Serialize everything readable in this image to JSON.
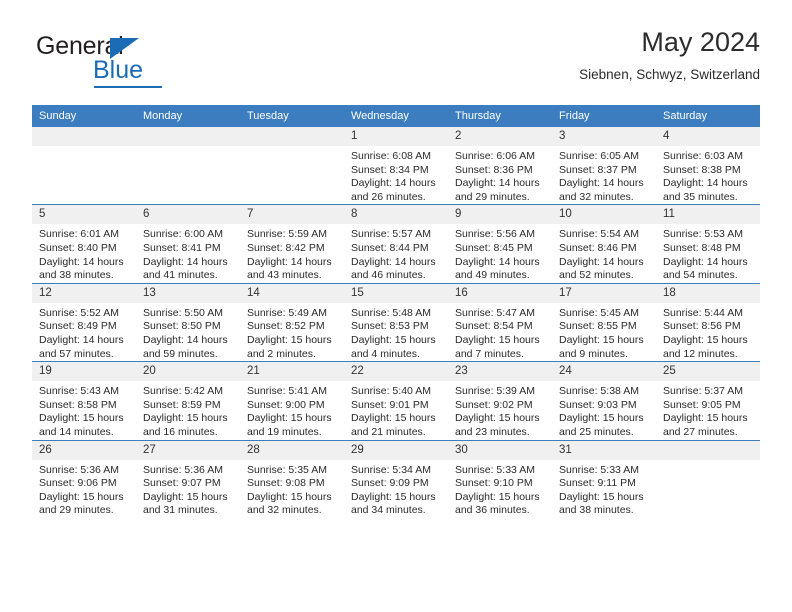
{
  "brand": {
    "name_part1": "General",
    "name_part2": "Blue",
    "accent_color": "#1b6cb5"
  },
  "header": {
    "title": "May 2024",
    "subtitle": "Siebnen, Schwyz, Switzerland"
  },
  "calendar": {
    "header_color": "#3b7dbf",
    "daynum_bg": "#f0f0f0",
    "weekday_headers": [
      "Sunday",
      "Monday",
      "Tuesday",
      "Wednesday",
      "Thursday",
      "Friday",
      "Saturday"
    ],
    "weeks": [
      [
        {
          "day": "",
          "blank": true,
          "sunrise": "",
          "sunset": "",
          "daylight": ""
        },
        {
          "day": "",
          "blank": true,
          "sunrise": "",
          "sunset": "",
          "daylight": ""
        },
        {
          "day": "",
          "blank": true,
          "sunrise": "",
          "sunset": "",
          "daylight": ""
        },
        {
          "day": "1",
          "sunrise": "Sunrise: 6:08 AM",
          "sunset": "Sunset: 8:34 PM",
          "daylight": "Daylight: 14 hours and 26 minutes."
        },
        {
          "day": "2",
          "sunrise": "Sunrise: 6:06 AM",
          "sunset": "Sunset: 8:36 PM",
          "daylight": "Daylight: 14 hours and 29 minutes."
        },
        {
          "day": "3",
          "sunrise": "Sunrise: 6:05 AM",
          "sunset": "Sunset: 8:37 PM",
          "daylight": "Daylight: 14 hours and 32 minutes."
        },
        {
          "day": "4",
          "sunrise": "Sunrise: 6:03 AM",
          "sunset": "Sunset: 8:38 PM",
          "daylight": "Daylight: 14 hours and 35 minutes."
        }
      ],
      [
        {
          "day": "5",
          "sunrise": "Sunrise: 6:01 AM",
          "sunset": "Sunset: 8:40 PM",
          "daylight": "Daylight: 14 hours and 38 minutes."
        },
        {
          "day": "6",
          "sunrise": "Sunrise: 6:00 AM",
          "sunset": "Sunset: 8:41 PM",
          "daylight": "Daylight: 14 hours and 41 minutes."
        },
        {
          "day": "7",
          "sunrise": "Sunrise: 5:59 AM",
          "sunset": "Sunset: 8:42 PM",
          "daylight": "Daylight: 14 hours and 43 minutes."
        },
        {
          "day": "8",
          "sunrise": "Sunrise: 5:57 AM",
          "sunset": "Sunset: 8:44 PM",
          "daylight": "Daylight: 14 hours and 46 minutes."
        },
        {
          "day": "9",
          "sunrise": "Sunrise: 5:56 AM",
          "sunset": "Sunset: 8:45 PM",
          "daylight": "Daylight: 14 hours and 49 minutes."
        },
        {
          "day": "10",
          "sunrise": "Sunrise: 5:54 AM",
          "sunset": "Sunset: 8:46 PM",
          "daylight": "Daylight: 14 hours and 52 minutes."
        },
        {
          "day": "11",
          "sunrise": "Sunrise: 5:53 AM",
          "sunset": "Sunset: 8:48 PM",
          "daylight": "Daylight: 14 hours and 54 minutes."
        }
      ],
      [
        {
          "day": "12",
          "sunrise": "Sunrise: 5:52 AM",
          "sunset": "Sunset: 8:49 PM",
          "daylight": "Daylight: 14 hours and 57 minutes."
        },
        {
          "day": "13",
          "sunrise": "Sunrise: 5:50 AM",
          "sunset": "Sunset: 8:50 PM",
          "daylight": "Daylight: 14 hours and 59 minutes."
        },
        {
          "day": "14",
          "sunrise": "Sunrise: 5:49 AM",
          "sunset": "Sunset: 8:52 PM",
          "daylight": "Daylight: 15 hours and 2 minutes."
        },
        {
          "day": "15",
          "sunrise": "Sunrise: 5:48 AM",
          "sunset": "Sunset: 8:53 PM",
          "daylight": "Daylight: 15 hours and 4 minutes."
        },
        {
          "day": "16",
          "sunrise": "Sunrise: 5:47 AM",
          "sunset": "Sunset: 8:54 PM",
          "daylight": "Daylight: 15 hours and 7 minutes."
        },
        {
          "day": "17",
          "sunrise": "Sunrise: 5:45 AM",
          "sunset": "Sunset: 8:55 PM",
          "daylight": "Daylight: 15 hours and 9 minutes."
        },
        {
          "day": "18",
          "sunrise": "Sunrise: 5:44 AM",
          "sunset": "Sunset: 8:56 PM",
          "daylight": "Daylight: 15 hours and 12 minutes."
        }
      ],
      [
        {
          "day": "19",
          "sunrise": "Sunrise: 5:43 AM",
          "sunset": "Sunset: 8:58 PM",
          "daylight": "Daylight: 15 hours and 14 minutes."
        },
        {
          "day": "20",
          "sunrise": "Sunrise: 5:42 AM",
          "sunset": "Sunset: 8:59 PM",
          "daylight": "Daylight: 15 hours and 16 minutes."
        },
        {
          "day": "21",
          "sunrise": "Sunrise: 5:41 AM",
          "sunset": "Sunset: 9:00 PM",
          "daylight": "Daylight: 15 hours and 19 minutes."
        },
        {
          "day": "22",
          "sunrise": "Sunrise: 5:40 AM",
          "sunset": "Sunset: 9:01 PM",
          "daylight": "Daylight: 15 hours and 21 minutes."
        },
        {
          "day": "23",
          "sunrise": "Sunrise: 5:39 AM",
          "sunset": "Sunset: 9:02 PM",
          "daylight": "Daylight: 15 hours and 23 minutes."
        },
        {
          "day": "24",
          "sunrise": "Sunrise: 5:38 AM",
          "sunset": "Sunset: 9:03 PM",
          "daylight": "Daylight: 15 hours and 25 minutes."
        },
        {
          "day": "25",
          "sunrise": "Sunrise: 5:37 AM",
          "sunset": "Sunset: 9:05 PM",
          "daylight": "Daylight: 15 hours and 27 minutes."
        }
      ],
      [
        {
          "day": "26",
          "sunrise": "Sunrise: 5:36 AM",
          "sunset": "Sunset: 9:06 PM",
          "daylight": "Daylight: 15 hours and 29 minutes."
        },
        {
          "day": "27",
          "sunrise": "Sunrise: 5:36 AM",
          "sunset": "Sunset: 9:07 PM",
          "daylight": "Daylight: 15 hours and 31 minutes."
        },
        {
          "day": "28",
          "sunrise": "Sunrise: 5:35 AM",
          "sunset": "Sunset: 9:08 PM",
          "daylight": "Daylight: 15 hours and 32 minutes."
        },
        {
          "day": "29",
          "sunrise": "Sunrise: 5:34 AM",
          "sunset": "Sunset: 9:09 PM",
          "daylight": "Daylight: 15 hours and 34 minutes."
        },
        {
          "day": "30",
          "sunrise": "Sunrise: 5:33 AM",
          "sunset": "Sunset: 9:10 PM",
          "daylight": "Daylight: 15 hours and 36 minutes."
        },
        {
          "day": "31",
          "sunrise": "Sunrise: 5:33 AM",
          "sunset": "Sunset: 9:11 PM",
          "daylight": "Daylight: 15 hours and 38 minutes."
        },
        {
          "day": "",
          "blank": true,
          "sunrise": "",
          "sunset": "",
          "daylight": ""
        }
      ]
    ]
  }
}
